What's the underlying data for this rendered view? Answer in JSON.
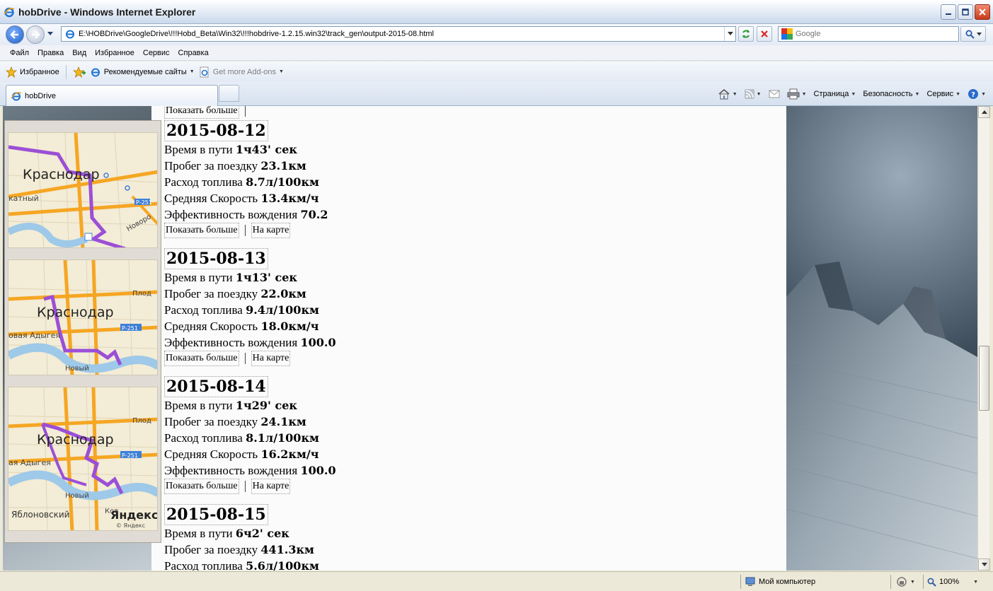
{
  "window": {
    "title": "hobDrive - Windows Internet Explorer"
  },
  "address": {
    "url": "E:\\HOBDrive\\GoogleDrive\\!!!Hobd_Beta\\Win32\\!!!hobdrive-1.2.15.win32\\track_gen\\output-2015-08.html"
  },
  "search": {
    "placeholder": "Google"
  },
  "menu": [
    "Файл",
    "Правка",
    "Вид",
    "Избранное",
    "Сервис",
    "Справка"
  ],
  "favorites": {
    "label": "Избранное",
    "suggested": "Рекомендуемые сайты",
    "addons": "Get more Add-ons"
  },
  "tab": {
    "label": "hobDrive"
  },
  "commands": {
    "page": "Страница",
    "safety": "Безопасность",
    "tools": "Сервис"
  },
  "maps": {
    "city": "Краснодар",
    "labels": [
      "катный",
      "Новоро",
      "Плод",
      "Р-251",
      "овая Адыгея",
      "Новый",
      "Плод",
      "Р-251",
      "ая Адыгея",
      "Новый",
      "Яблоновский",
      "Кот"
    ],
    "brand": "Яндекс",
    "brand_copy": "© Яндекс",
    "colors": {
      "route": "#9b4fd6",
      "road": "#f5a623",
      "water": "#9ec9e8",
      "land": "#f3ecd6"
    }
  },
  "trips": [
    {
      "date": "2015-08-12",
      "time_label": "Время в пути",
      "time_value": "1ч43' сек",
      "distance_label": "Пробег за поездку",
      "distance_value": "23.1км",
      "fuel_label": "Расход топлива",
      "fuel_value": "8.7л/100км",
      "speed_label": "Средняя Скорость",
      "speed_value": "13.4км/ч",
      "efficiency_label": "Эффективность вождения",
      "efficiency_value": "70.2",
      "more_link": "Показать больше",
      "map_link": "На карте"
    },
    {
      "date": "2015-08-13",
      "time_label": "Время в пути",
      "time_value": "1ч13' сек",
      "distance_label": "Пробег за поездку",
      "distance_value": "22.0км",
      "fuel_label": "Расход топлива",
      "fuel_value": "9.4л/100км",
      "speed_label": "Средняя Скорость",
      "speed_value": "18.0км/ч",
      "efficiency_label": "Эффективность вождения",
      "efficiency_value": "100.0",
      "more_link": "Показать больше",
      "map_link": "На карте"
    },
    {
      "date": "2015-08-14",
      "time_label": "Время в пути",
      "time_value": "1ч29' сек",
      "distance_label": "Пробег за поездку",
      "distance_value": "24.1км",
      "fuel_label": "Расход топлива",
      "fuel_value": "8.1л/100км",
      "speed_label": "Средняя Скорость",
      "speed_value": "16.2км/ч",
      "efficiency_label": "Эффективность вождения",
      "efficiency_value": "100.0",
      "more_link": "Показать больше",
      "map_link": "На карте"
    },
    {
      "date": "2015-08-15",
      "time_label": "Время в пути",
      "time_value": "6ч2' сек",
      "distance_label": "Пробег за поездку",
      "distance_value": "441.3км",
      "fuel_label": "Расход топлива",
      "fuel_value": "5.6л/100км"
    }
  ],
  "top_partial": {
    "more_link": "Показать больше"
  },
  "status": {
    "zone": "Мой компьютер",
    "zoom": "100%"
  }
}
